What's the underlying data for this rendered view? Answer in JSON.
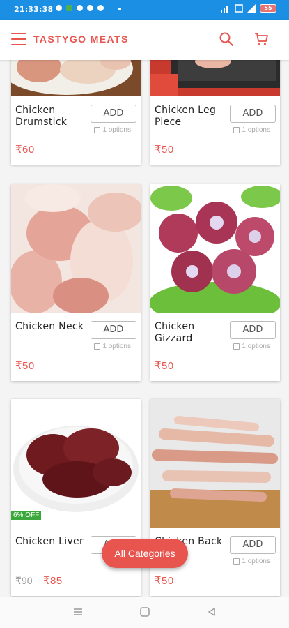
{
  "status": {
    "time": "21:33:38",
    "battery": "55"
  },
  "header": {
    "brand": "TASTYGO MEATS"
  },
  "products": [
    {
      "name": "Chicken Drumstick",
      "add_label": "ADD",
      "options": "1 options",
      "price": "₹60"
    },
    {
      "name": "Chicken Leg Piece",
      "add_label": "ADD",
      "options": "1 options",
      "price": "₹50"
    },
    {
      "name": "Chicken Neck",
      "add_label": "ADD",
      "options": "1 options",
      "price": "₹50"
    },
    {
      "name": "Chicken Gizzard",
      "add_label": "ADD",
      "options": "1 options",
      "price": "₹50"
    },
    {
      "name": "Chicken Liver",
      "add_label": "ADD",
      "options": "",
      "price": "₹85",
      "old_price": "₹90",
      "discount": "6% OFF"
    },
    {
      "name": "Chicken Back Bone",
      "add_label": "ADD",
      "options": "1 options",
      "price": "₹50"
    }
  ],
  "fab": {
    "label": "All Categories"
  },
  "colors": {
    "brand": "#e8554e",
    "statusbar": "#1a8fe3",
    "discount": "#3aa83a"
  },
  "icons": {
    "menu": "hamburger-icon",
    "search": "search-icon",
    "cart": "cart-icon"
  }
}
